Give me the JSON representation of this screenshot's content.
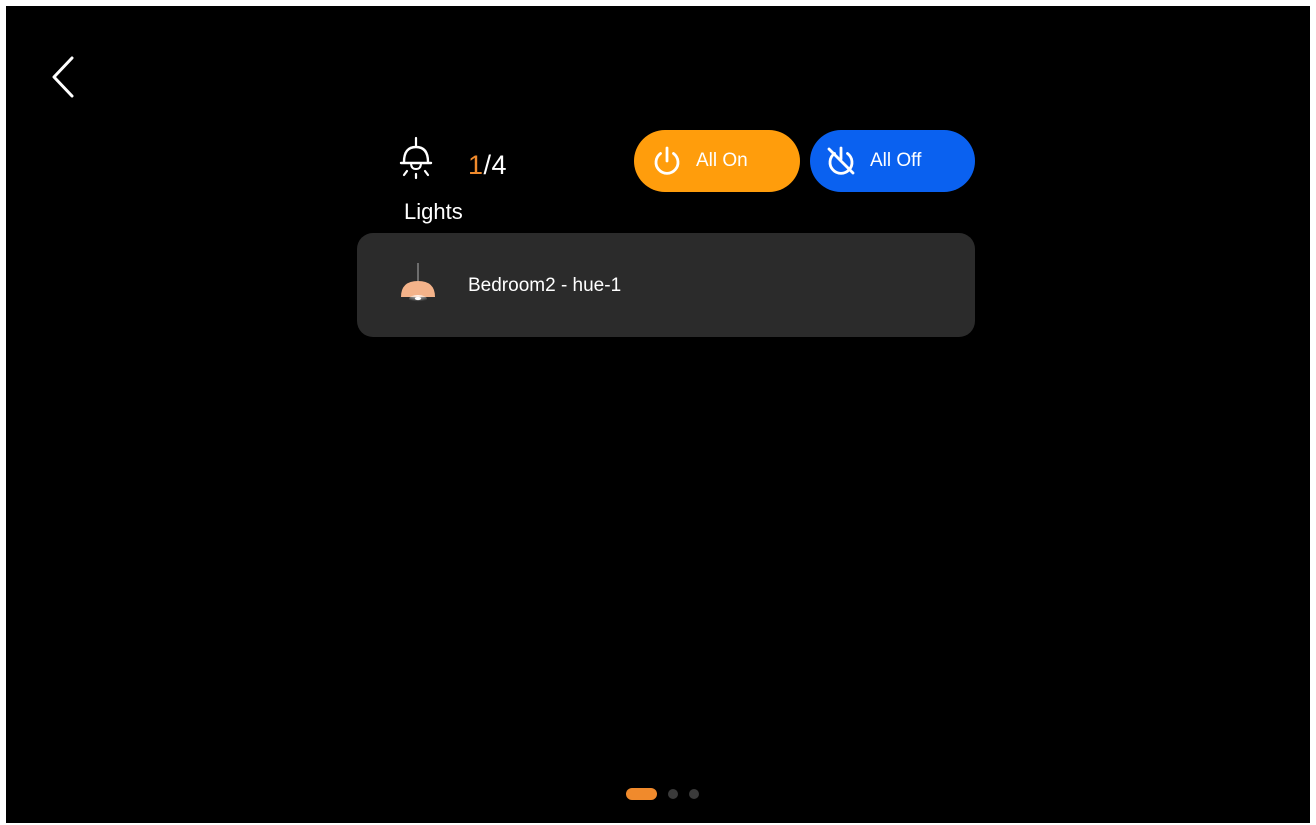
{
  "header": {
    "count_on": "1",
    "count_total": "/4",
    "section_label": "Lights"
  },
  "actions": {
    "all_on_label": "All On",
    "all_off_label": "All Off"
  },
  "devices": [
    {
      "name": "Bedroom2 - hue-1",
      "icon": "pendant-lamp-icon"
    }
  ],
  "pagination": {
    "pages": 3,
    "current": 1
  },
  "colors": {
    "background": "#000000",
    "accent_orange": "#ff9d0c",
    "accent_blue": "#0a61f0",
    "card": "#2b2b2b",
    "count_highlight": "#f08a2c"
  },
  "icons": {
    "back": "chevron-left-icon",
    "header": "ceiling-light-icon",
    "all_on": "power-icon",
    "all_off": "power-off-icon"
  }
}
